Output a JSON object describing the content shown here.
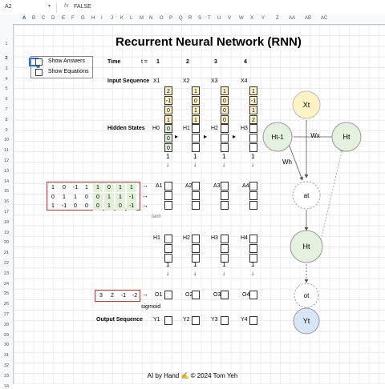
{
  "formula_bar": {
    "cell_ref": "A2",
    "fx_icon": "fx",
    "value": "FALSE"
  },
  "columns": [
    "A",
    "B",
    "C",
    "D",
    "E",
    "F",
    "G",
    "H",
    "I",
    "J",
    "K",
    "L",
    "M",
    "N",
    "O",
    "P",
    "Q",
    "R",
    "S",
    "T",
    "U",
    "V",
    "W",
    "X",
    "Y",
    "Z",
    "AA",
    "AB",
    "AC"
  ],
  "rows": [
    "1",
    "2",
    "3",
    "4",
    "5",
    "6",
    "7",
    "8",
    "9",
    "10",
    "11",
    "12",
    "13",
    "14",
    "15",
    "16",
    "17",
    "18",
    "19",
    "20",
    "21",
    "22",
    "23",
    "24",
    "25",
    "26",
    "27",
    "28",
    "29",
    "30",
    "31",
    "32",
    "33",
    "34"
  ],
  "title": "Recurrent Neural Network (RNN)",
  "controls": {
    "show_answers": "Show Answers",
    "show_equations": "Show Equations"
  },
  "time": {
    "label": "Time",
    "t_label": "t =",
    "steps": [
      "1",
      "2",
      "3",
      "4"
    ]
  },
  "input_sequence": {
    "label": "Input Sequence",
    "vectors": [
      {
        "name": "X1",
        "values": [
          "2",
          "-1",
          "0",
          "1"
        ]
      },
      {
        "name": "X2",
        "values": [
          "1",
          "0",
          "1",
          "1"
        ]
      },
      {
        "name": "X3",
        "values": [
          "1",
          "0",
          "0",
          "0"
        ]
      },
      {
        "name": "X4",
        "values": [
          "1",
          "-1",
          "1",
          "2"
        ]
      }
    ]
  },
  "hidden_states": {
    "label": "Hidden States",
    "h0": {
      "name": "H0",
      "values": [
        "0",
        "0",
        "0"
      ]
    },
    "names": [
      "H1",
      "H2",
      "H3"
    ]
  },
  "weights_hidden": [
    [
      "1",
      "0",
      "-1",
      "1",
      "1",
      "0",
      "1",
      "1"
    ],
    [
      "0",
      "1",
      "1",
      "0",
      "0",
      "1",
      "1",
      "-1"
    ],
    [
      "1",
      "-1",
      "0",
      "0",
      "0",
      "1",
      "0",
      "-1"
    ]
  ],
  "a_nodes": [
    "A1",
    "A2",
    "A3",
    "A4"
  ],
  "tanh_label": "tanh",
  "h_nodes": [
    "H1",
    "H2",
    "H3",
    "H4"
  ],
  "weights_output": [
    "3",
    "2",
    "-1",
    "-2"
  ],
  "o_nodes": [
    "O1",
    "O2",
    "O3",
    "O4"
  ],
  "sigmoid_label": "sigmoid",
  "output_sequence": {
    "label": "Output Sequence",
    "names": [
      "Y1",
      "Y2",
      "Y3",
      "Y4"
    ]
  },
  "diagram": {
    "xt": "Xt",
    "ht_prev": "Ht-1",
    "ht_right": "Ht",
    "wx": "Wx",
    "wh": "Wh",
    "at": "at",
    "ht": "Ht",
    "ot": "ot",
    "yt": "Yt",
    "colors": {
      "yellow": "#fff2c4",
      "green": "#e3f1de",
      "blue": "#d6e6f7",
      "dashed": "#999999"
    }
  },
  "footer": "AI by Hand ✍️ © 2024 Tom Yeh"
}
